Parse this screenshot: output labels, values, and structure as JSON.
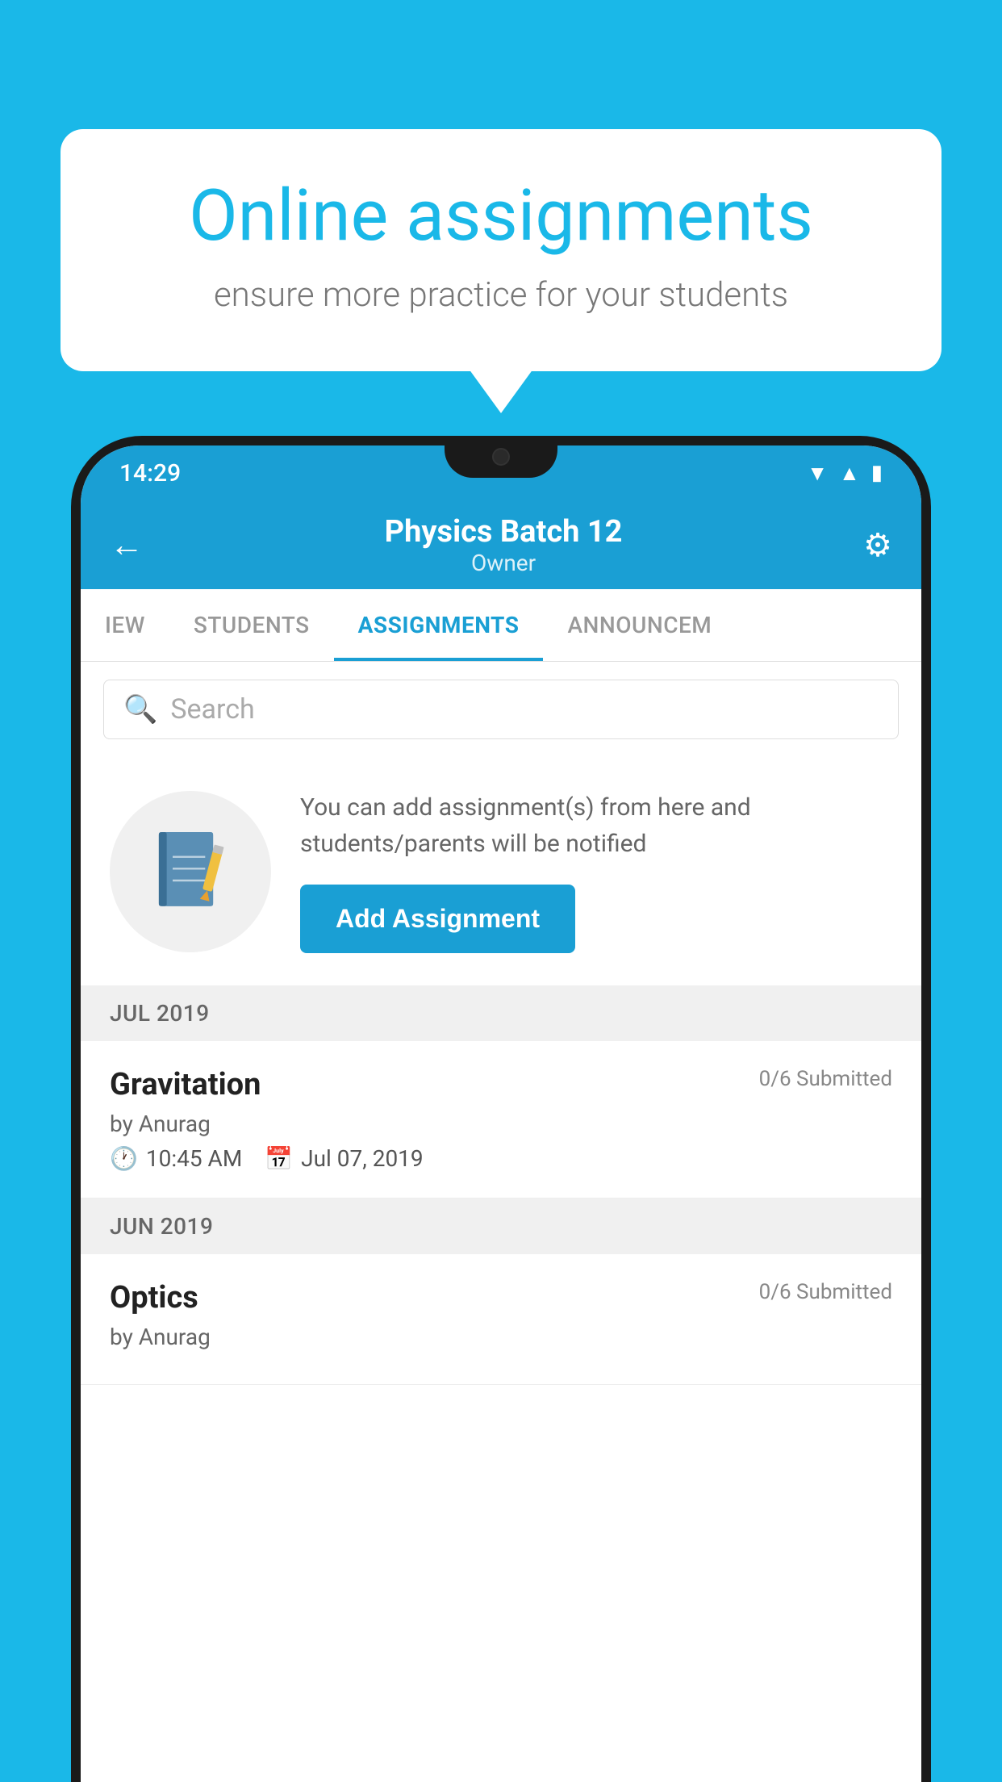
{
  "background_color": "#1ab8e8",
  "bubble": {
    "title": "Online assignments",
    "subtitle": "ensure more practice for your students"
  },
  "phone": {
    "status_bar": {
      "time": "14:29",
      "icons": [
        "wifi",
        "signal",
        "battery"
      ]
    },
    "header": {
      "title": "Physics Batch 12",
      "subtitle": "Owner",
      "back_label": "←",
      "settings_label": "⚙"
    },
    "tabs": [
      {
        "label": "IEW",
        "active": false
      },
      {
        "label": "STUDENTS",
        "active": false
      },
      {
        "label": "ASSIGNMENTS",
        "active": true
      },
      {
        "label": "ANNOUNCEM",
        "active": false
      }
    ],
    "search": {
      "placeholder": "Search"
    },
    "add_section": {
      "description": "You can add assignment(s) from here and students/parents will be notified",
      "button_label": "Add Assignment"
    },
    "sections": [
      {
        "month_label": "JUL 2019",
        "assignments": [
          {
            "name": "Gravitation",
            "submitted": "0/6 Submitted",
            "by": "by Anurag",
            "time": "10:45 AM",
            "date": "Jul 07, 2019"
          }
        ]
      },
      {
        "month_label": "JUN 2019",
        "assignments": [
          {
            "name": "Optics",
            "submitted": "0/6 Submitted",
            "by": "by Anurag",
            "time": "",
            "date": ""
          }
        ]
      }
    ]
  }
}
